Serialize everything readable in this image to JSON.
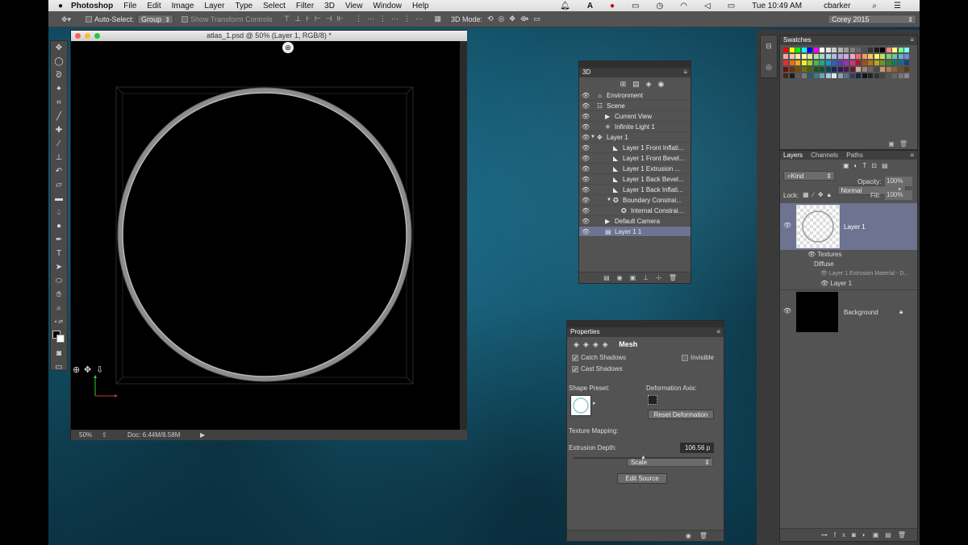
{
  "menubar": {
    "apple": "",
    "app": "Photoshop",
    "items": [
      "File",
      "Edit",
      "Image",
      "Layer",
      "Type",
      "Select",
      "Filter",
      "3D",
      "View",
      "Window",
      "Help"
    ],
    "clock": "Tue 10:49 AM",
    "user": "cbarker"
  },
  "options": {
    "auto_select": "Auto-Select:",
    "group": "Group",
    "transform": "Show Transform Controls",
    "mode_3d": "3D Mode:",
    "workspace": "Corey 2015"
  },
  "document": {
    "title": "atlas_1.psd @ 50% (Layer 1, RGB/8) *",
    "zoom": "50%",
    "doc_size": "Doc: 6.44M/8.58M"
  },
  "panel_3d": {
    "title": "3D",
    "rows": [
      {
        "label": "Environment",
        "indent": 0,
        "icon": "globe"
      },
      {
        "label": "Scene",
        "indent": 0,
        "icon": "scene"
      },
      {
        "label": "Current View",
        "indent": 1,
        "icon": "camera"
      },
      {
        "label": "Infinite Light 1",
        "indent": 1,
        "icon": "light"
      },
      {
        "label": "Layer 1",
        "indent": 0,
        "icon": "mesh",
        "twisty": "▼"
      },
      {
        "label": "Layer 1 Front Inflati...",
        "indent": 2,
        "icon": "material"
      },
      {
        "label": "Layer 1 Front Bevel...",
        "indent": 2,
        "icon": "material"
      },
      {
        "label": "Layer 1 Extrusion ...",
        "indent": 2,
        "icon": "material"
      },
      {
        "label": "Layer 1 Back Bevel...",
        "indent": 2,
        "icon": "material"
      },
      {
        "label": "Layer 1 Back Inflati...",
        "indent": 2,
        "icon": "material"
      },
      {
        "label": "Boundary Constrai...",
        "indent": 2,
        "icon": "constraint",
        "twisty": "▼"
      },
      {
        "label": "Internal Constrai...",
        "indent": 3,
        "icon": "constraint"
      },
      {
        "label": "Default Camera",
        "indent": 1,
        "icon": "camera"
      },
      {
        "label": "Layer 1 1",
        "indent": 1,
        "icon": "mesh2",
        "selected": true
      }
    ]
  },
  "properties": {
    "title": "Properties",
    "mode": "Mesh",
    "catch_shadows": "Catch Shadows",
    "cast_shadows": "Cast Shadows",
    "invisible": "Invisible",
    "shape_preset": "Shape Preset:",
    "deformation_axis": "Deformation Axis:",
    "reset_deformation": "Reset Deformation",
    "texture_mapping": "Texture Mapping:",
    "texture_value": "Scale",
    "extrusion_depth": "Extrusion Depth:",
    "extrusion_value": "106.56 p",
    "edit_source": "Edit Source"
  },
  "swatches": {
    "title": "Swatches"
  },
  "layers": {
    "tabs": [
      "Layers",
      "Channels",
      "Paths"
    ],
    "kind": "Kind",
    "blend": "Normal",
    "opacity_label": "Opacity:",
    "opacity": "100%",
    "lock_label": "Lock:",
    "fill_label": "Fill:",
    "fill": "100%",
    "layer1": "Layer 1",
    "textures": "Textures",
    "diffuse": "Diffuse",
    "material": "Layer 1 Extrusion Material - D...",
    "sublayer": "Layer 1",
    "background": "Background"
  },
  "colors": {
    "accent": "#6d7390",
    "panel": "#535353",
    "desktop": "#15566e"
  }
}
